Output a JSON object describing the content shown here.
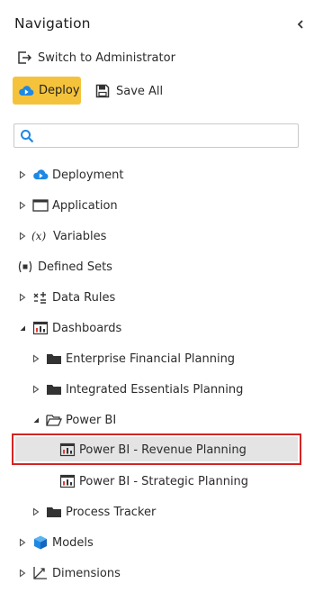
{
  "header": {
    "title": "Navigation"
  },
  "actions": {
    "switch_label": "Switch to Administrator",
    "deploy_label": "Deploy",
    "save_label": "Save All"
  },
  "search": {
    "value": "",
    "placeholder": ""
  },
  "colors": {
    "deploy_bg": "#f5c33b",
    "selection_border": "#d42424",
    "selection_bg": "#e4e4e4",
    "accent_blue": "#1e88e5"
  },
  "tree": {
    "deployment": "Deployment",
    "application": "Application",
    "variables": "Variables",
    "variables_prefix": "(x)",
    "defined_sets": "Defined Sets",
    "data_rules": "Data Rules",
    "dashboards": "Dashboards",
    "enterprise": "Enterprise Financial Planning",
    "integrated": "Integrated Essentials Planning",
    "powerbi": "Power BI",
    "revenue": "Power BI - Revenue Planning",
    "strategic": "Power BI - Strategic Planning",
    "process": "Process Tracker",
    "models": "Models",
    "dimensions": "Dimensions"
  }
}
